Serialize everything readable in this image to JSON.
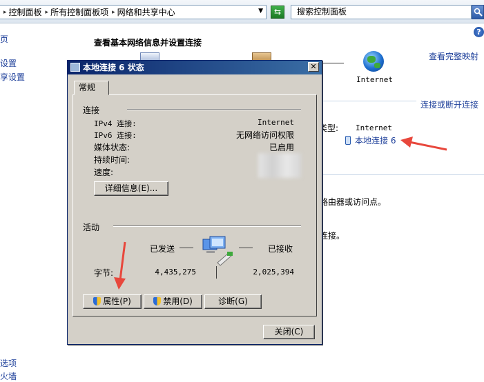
{
  "address_bar": {
    "crumbs": [
      "控制面板",
      "所有控制面板项",
      "网络和共享中心"
    ],
    "search_placeholder": "搜索控制面板"
  },
  "background": {
    "help_label": "?",
    "sidebar": [
      "页",
      "设置",
      "享设置"
    ],
    "sidebar_bottom": [
      "选项",
      "火墙"
    ],
    "title": "查看基本网络信息并设置连接",
    "view_full_map": "查看完整映射",
    "internet_caption": "Internet",
    "connect_disconnect": "连接或断开连接",
    "access_type_label": "类型:",
    "access_type_value": "Internet",
    "connection_link": "本地连接 6",
    "router_text": "路由器或访问点。",
    "connect_text": "连接。"
  },
  "dialog": {
    "title": "本地连接 6 状态",
    "close_glyph": "✕",
    "tab": "常规",
    "connection_group": "连接",
    "rows": [
      {
        "label": "IPv4 连接:",
        "value": "Internet"
      },
      {
        "label": "IPv6 连接:",
        "value": "无网络访问权限"
      },
      {
        "label": "媒体状态:",
        "value": "已启用"
      },
      {
        "label": "持续时间:",
        "value": ""
      },
      {
        "label": "速度:",
        "value": ""
      }
    ],
    "details_button": "详细信息(E)...",
    "activity_group": "活动",
    "sent_label": "已发送",
    "received_label": "已接收",
    "bytes_label": "字节:",
    "bytes_sent": "4,435,275",
    "bytes_received": "2,025,394",
    "properties_button": "属性(P)",
    "disable_button": "禁用(D)",
    "diagnose_button": "诊断(G)",
    "close_button": "关闭(C)"
  },
  "colors": {
    "link": "#1d3f9a",
    "annotation_arrow": "#e8473c",
    "dialog_bg": "#d4d0c8",
    "title_bar": "#0a246a"
  }
}
